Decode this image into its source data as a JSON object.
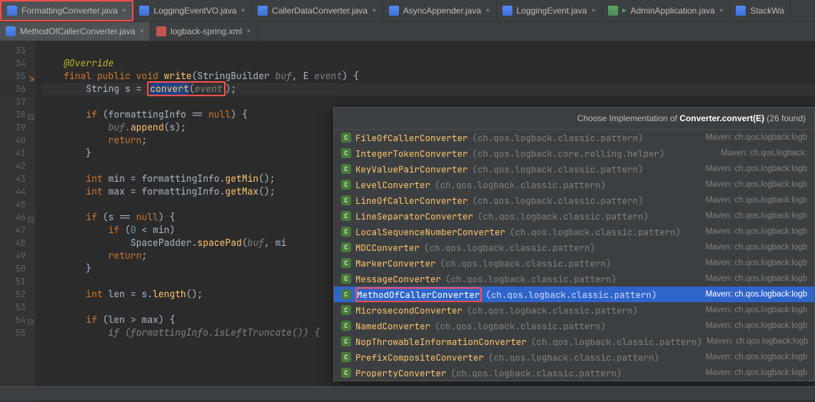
{
  "tabsRow1": [
    {
      "label": "FormattingConverter.java",
      "icon": "java",
      "active": true,
      "boxed": true
    },
    {
      "label": "LoggingEventVO.java",
      "icon": "java"
    },
    {
      "label": "CallerDataConverter.java",
      "icon": "java"
    },
    {
      "label": "AsyncAppender.java",
      "icon": "java"
    },
    {
      "label": "LoggingEvent.java",
      "icon": "java"
    },
    {
      "label": "AdminApplication.java",
      "icon": "java-green",
      "runnable": true
    },
    {
      "label": "StackWa",
      "icon": "java",
      "truncated": true
    }
  ],
  "tabsRow2": [
    {
      "label": "MethodOfCallerConverter.java",
      "icon": "java",
      "active": true
    },
    {
      "label": "logback-spring.xml",
      "icon": "xml"
    }
  ],
  "gutter": [
    {
      "n": "33"
    },
    {
      "n": "34"
    },
    {
      "n": "35",
      "impl": true
    },
    {
      "n": "36",
      "hl": true
    },
    {
      "n": "37"
    },
    {
      "n": "38",
      "fold": true
    },
    {
      "n": "39"
    },
    {
      "n": "40"
    },
    {
      "n": "41"
    },
    {
      "n": "42"
    },
    {
      "n": "43"
    },
    {
      "n": "44"
    },
    {
      "n": "45"
    },
    {
      "n": "46",
      "fold": true
    },
    {
      "n": "47"
    },
    {
      "n": "48"
    },
    {
      "n": "49"
    },
    {
      "n": "50"
    },
    {
      "n": "51"
    },
    {
      "n": "52"
    },
    {
      "n": "53"
    },
    {
      "n": "54",
      "fold": true
    },
    {
      "n": "55"
    }
  ],
  "code": {
    "l33": "",
    "l34_ann": "@Override",
    "l35_a": "final public void ",
    "l35_m": "write",
    "l35_b": "(StringBuilder ",
    "l35_p1": "buf",
    "l35_c": ", E ",
    "l35_p2": "event",
    "l35_d": ") {",
    "l36_a": "String s = ",
    "l36_conv": "convert",
    "l36_b": "(",
    "l36_ev": "event",
    "l36_c": ");",
    "l38_a": "if ",
    "l38_b": "(formattingInfo == ",
    "l38_n": "null",
    "l38_c": ") {",
    "l39_a": "buf.",
    "l39_m": "append",
    "l39_b": "(s);",
    "l40": "return",
    "l41": "}",
    "l43_a": "int ",
    "l43_b": "min = formattingInfo.",
    "l43_m": "getMin",
    "l43_c": "();",
    "l44_a": "int ",
    "l44_b": "max = formattingInfo.",
    "l44_m": "getMax",
    "l44_c": "();",
    "l46_a": "if ",
    "l46_b": "(s == ",
    "l46_n": "null",
    "l46_c": ") {",
    "l47_a": "if ",
    "l47_b": "(",
    "l47_n": "0",
    "l47_c": " < min)",
    "l48_a": "SpacePadder.",
    "l48_m": "spacePad",
    "l48_b": "(",
    "l48_p": "buf",
    "l48_c": ", mi",
    "l49": "return",
    "l50": "}",
    "l52_a": "int ",
    "l52_b": "len = s.",
    "l52_m": "length",
    "l52_c": "();",
    "l54_a": "if ",
    "l54_b": "(len > max) {",
    "l55": "if (formattingInfo.isLeftTruncate()) {"
  },
  "popup": {
    "title_a": "Choose Implementation of ",
    "title_b": "Converter.convert(E)",
    "title_c": " (26 found)",
    "rows": [
      {
        "name": "FileOfCallerConverter",
        "pkg": "(ch.qos.logback.classic.pattern)",
        "src": "Maven: ch.qos.logback:logb"
      },
      {
        "name": "IntegerTokenConverter",
        "pkg": "(ch.qos.logback.core.rolling.helper)",
        "src": "Maven: ch.qos.logback:"
      },
      {
        "name": "KeyValuePairConverter",
        "pkg": "(ch.qos.logback.classic.pattern)",
        "src": "Maven: ch.qos.logback:logb"
      },
      {
        "name": "LevelConverter",
        "pkg": "(ch.qos.logback.classic.pattern)",
        "src": "Maven: ch.qos.logback:logb"
      },
      {
        "name": "LineOfCallerConverter",
        "pkg": "(ch.qos.logback.classic.pattern)",
        "src": "Maven: ch.qos.logback:logb"
      },
      {
        "name": "LineSeparatorConverter",
        "pkg": "(ch.qos.logback.classic.pattern)",
        "src": "Maven: ch.qos.logback:logb"
      },
      {
        "name": "LocalSequenceNumberConverter",
        "pkg": "(ch.qos.logback.classic.pattern)",
        "src": "Maven: ch.qos.logback:logb"
      },
      {
        "name": "MDCConverter",
        "pkg": "(ch.qos.logback.classic.pattern)",
        "src": "Maven: ch.qos.logback:logb"
      },
      {
        "name": "MarkerConverter",
        "pkg": "(ch.qos.logback.classic.pattern)",
        "src": "Maven: ch.qos.logback:logb"
      },
      {
        "name": "MessageConverter",
        "pkg": "(ch.qos.logback.classic.pattern)",
        "src": "Maven: ch.qos.logback:logb"
      },
      {
        "name": "MethodOfCallerConverter",
        "pkg": "(ch.qos.logback.classic.pattern)",
        "src": "Maven: ch.qos.logback:logb",
        "sel": true,
        "boxed": true
      },
      {
        "name": "MicrosecondConverter",
        "pkg": "(ch.qos.logback.classic.pattern)",
        "src": "Maven: ch.qos.logback:logb"
      },
      {
        "name": "NamedConverter",
        "pkg": "(ch.qos.logback.classic.pattern)",
        "src": "Maven: ch.qos.logback:logb"
      },
      {
        "name": "NopThrowableInformationConverter",
        "pkg": "(ch.qos.logback.classic.pattern)",
        "src": "Maven: ch.qos.logback:logb"
      },
      {
        "name": "PrefixCompositeConverter",
        "pkg": "(ch.qos.logback.classic.pattern)",
        "src": "Maven: ch.qos.logback:logb"
      },
      {
        "name": "PropertyConverter",
        "pkg": "(ch.qos.logback.classic.pattern)",
        "src": "Maven: ch.qos.logback:logb"
      }
    ]
  }
}
